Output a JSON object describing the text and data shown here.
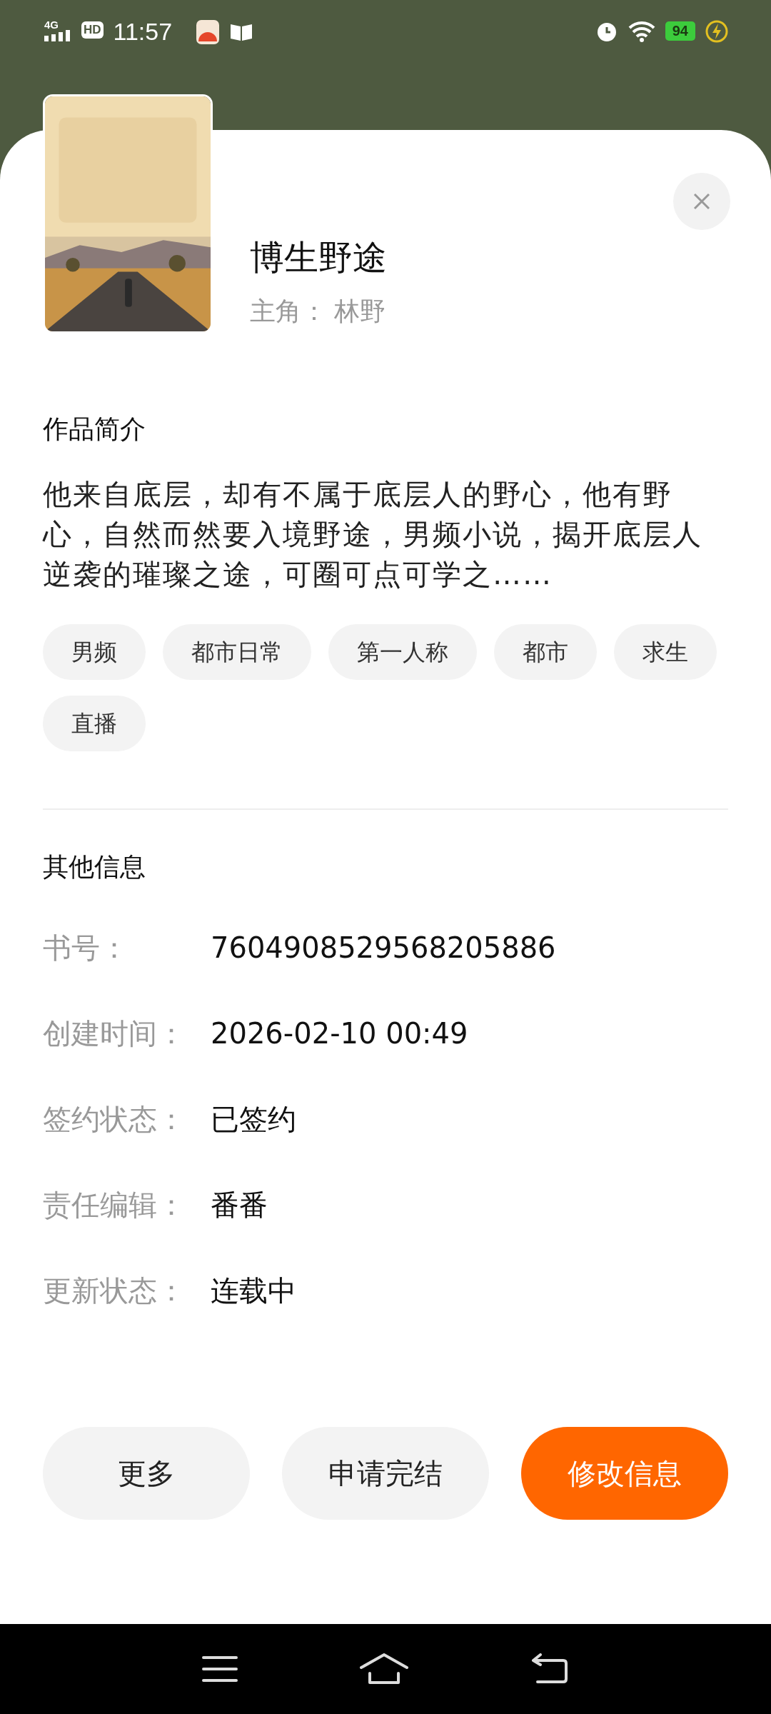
{
  "status_bar": {
    "network": "4G",
    "hd": "HD",
    "time": "11:57",
    "battery": "94"
  },
  "book": {
    "title": "博生野途",
    "protagonist_label": "主角：",
    "protagonist": "林野"
  },
  "intro": {
    "heading": "作品简介",
    "text": "他来自底层，却有不属于底层人的野心，他有野心，自然而然要入境野途，男频小说，揭开底层人逆袭的璀璨之途，可圈可点可学之……"
  },
  "tags": [
    "男频",
    "都市日常",
    "第一人称",
    "都市",
    "求生",
    "直播"
  ],
  "info": {
    "heading": "其他信息",
    "rows": [
      {
        "label": "书号：",
        "value": "7604908529568205886"
      },
      {
        "label": "创建时间：",
        "value": "2026-02-10 00:49"
      },
      {
        "label": "签约状态：",
        "value": "已签约"
      },
      {
        "label": "责任编辑：",
        "value": "番番"
      },
      {
        "label": "更新状态：",
        "value": "连载中"
      }
    ]
  },
  "actions": [
    {
      "label": "更多",
      "primary": false
    },
    {
      "label": "申请完结",
      "primary": false
    },
    {
      "label": "修改信息",
      "primary": true
    }
  ]
}
